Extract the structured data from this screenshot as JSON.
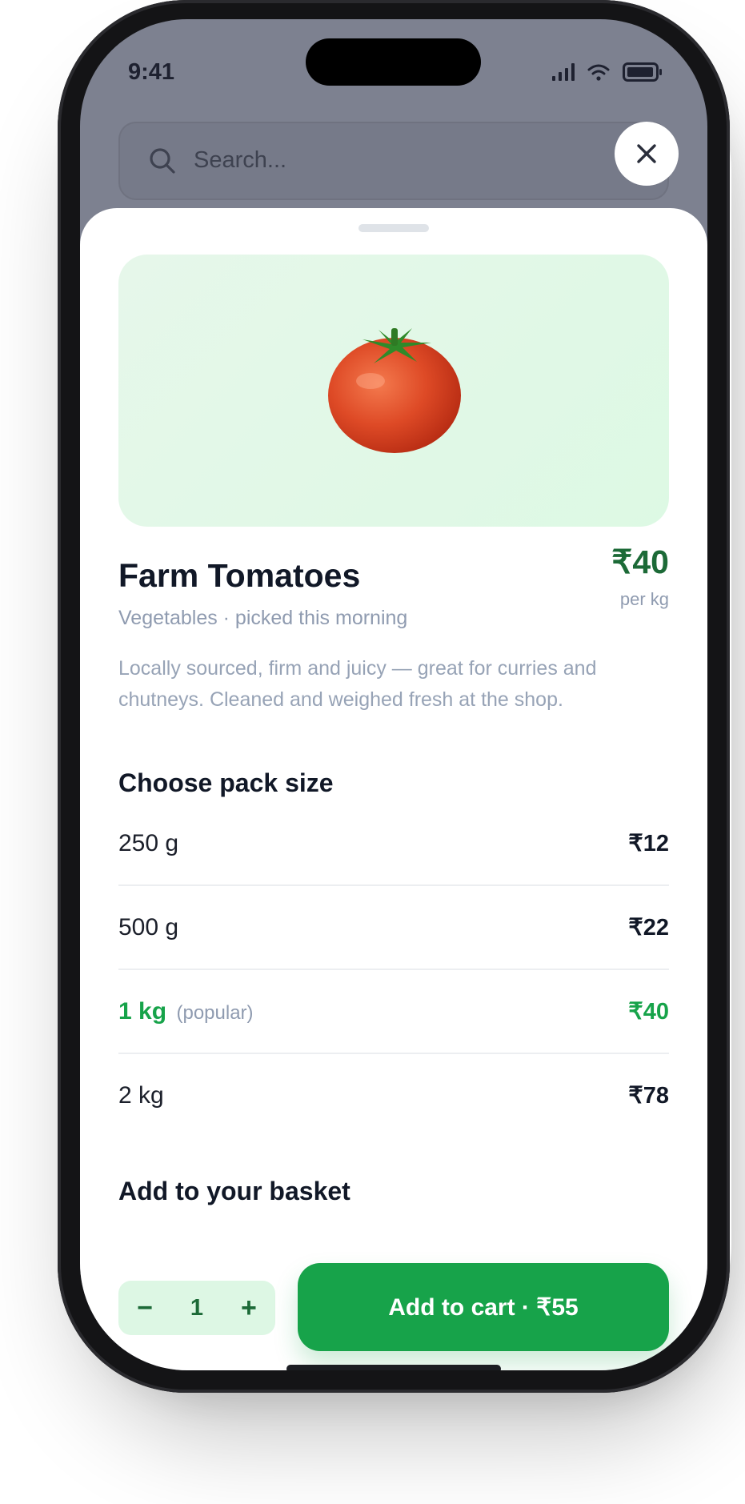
{
  "status_bar": {
    "time": "9:41"
  },
  "search": {
    "placeholder": "Search..."
  },
  "product": {
    "name": "Farm Tomatoes",
    "subtitle": "Vegetables · picked this morning",
    "price": "₹40",
    "price_unit": "per kg",
    "description": "Locally sourced, firm and juicy — great for curries and chutneys. Cleaned and weighed fresh at the shop."
  },
  "pack_section": {
    "heading": "Choose pack size",
    "options": [
      {
        "label": "250 g",
        "tag": "",
        "price": "₹12"
      },
      {
        "label": "500 g",
        "tag": "",
        "price": "₹22"
      },
      {
        "label": "1 kg",
        "tag": "(popular)",
        "price": "₹40"
      },
      {
        "label": "2 kg",
        "tag": "",
        "price": "₹78"
      }
    ]
  },
  "basket": {
    "heading": "Add to your basket",
    "quantity": "1",
    "decrement_label": "−",
    "increment_label": "+",
    "cta_label": "Add to cart · ₹55"
  },
  "colors": {
    "accent": "#17a34a",
    "price_green": "#1c6a37",
    "hero_bg": "#e3f8e8",
    "overlay": "#7d8190"
  },
  "icons": [
    "search-icon",
    "close-icon",
    "signal-icon",
    "wifi-icon",
    "battery-icon",
    "tomato-image"
  ]
}
